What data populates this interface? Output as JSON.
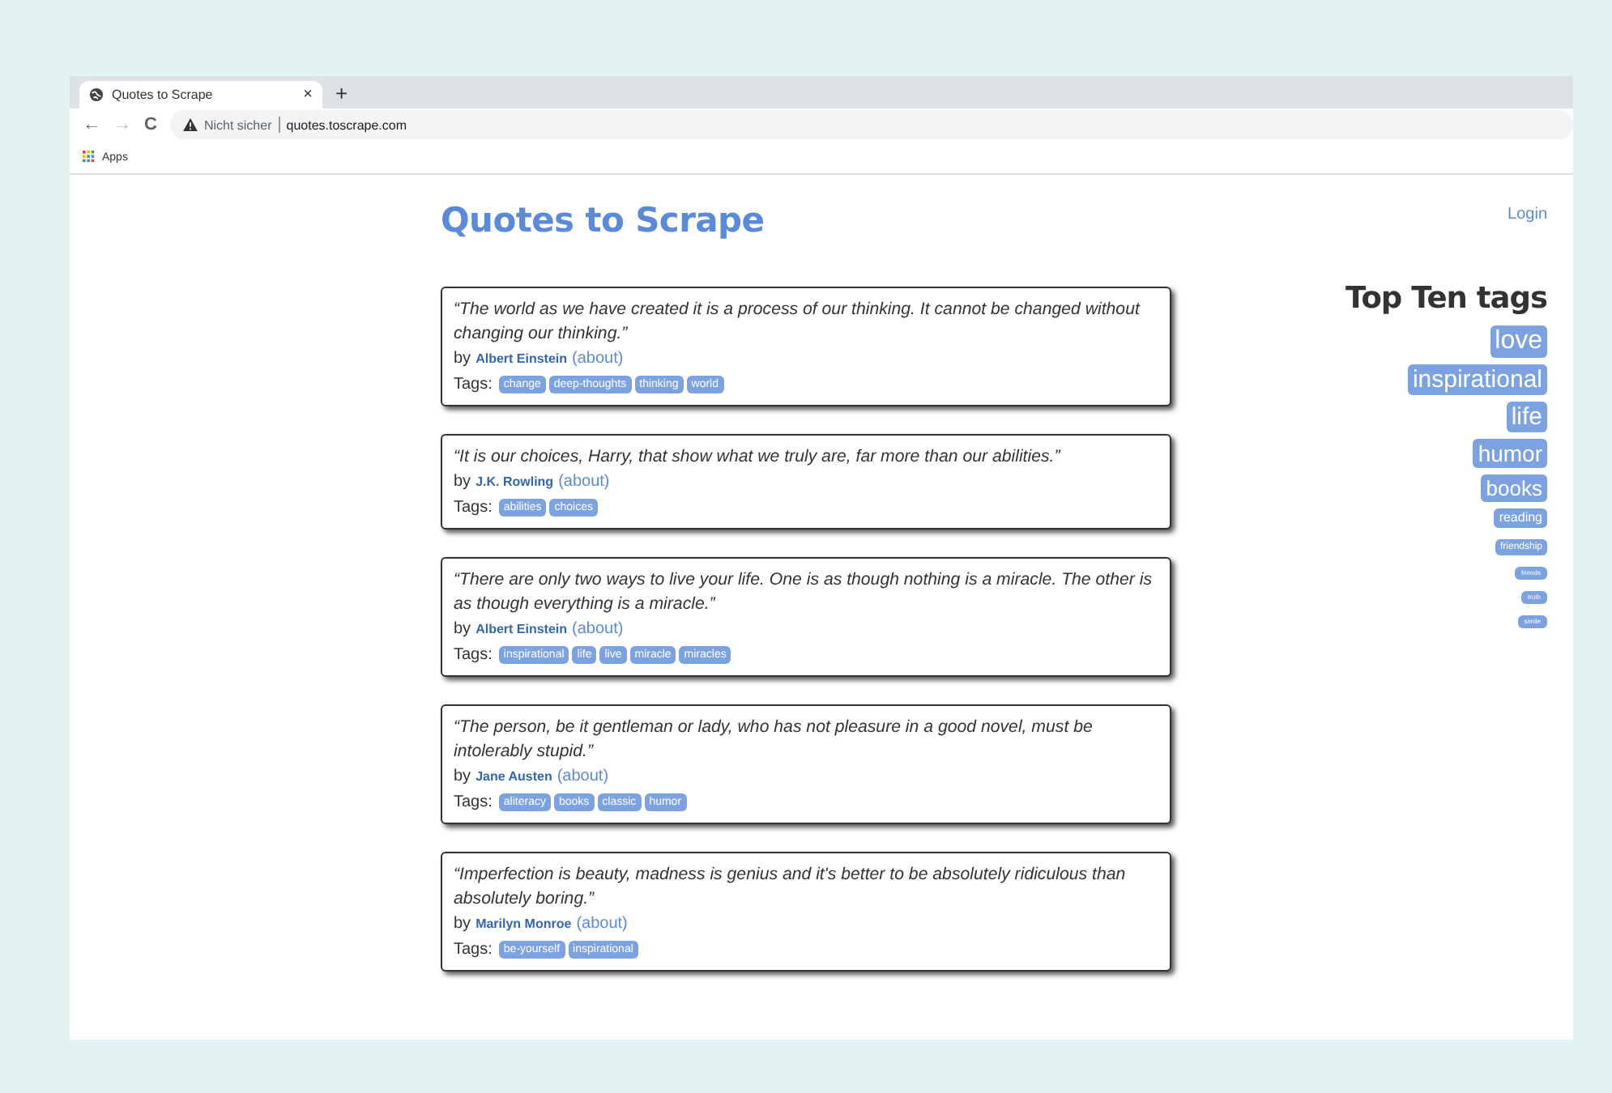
{
  "browser": {
    "tab_title": "Quotes to Scrape",
    "tab_close": "×",
    "new_tab": "+",
    "back": "←",
    "forward": "→",
    "reload": "C",
    "security": "Nicht sicher",
    "url": "quotes.toscrape.com",
    "bookmarks": [
      {
        "label": "Apps"
      }
    ]
  },
  "page": {
    "title": "Quotes to Scrape",
    "login": "Login",
    "quotes": [
      {
        "text": "“The world as we have created it is a process of our thinking. It cannot be changed without changing our thinking.”",
        "by": "by",
        "author": "Albert Einstein",
        "about": "(about)",
        "tags_label": "Tags:",
        "tags": [
          "change",
          "deep-thoughts",
          "thinking",
          "world"
        ]
      },
      {
        "text": "“It is our choices, Harry, that show what we truly are, far more than our abilities.”",
        "by": "by",
        "author": "J.K. Rowling",
        "about": "(about)",
        "tags_label": "Tags:",
        "tags": [
          "abilities",
          "choices"
        ]
      },
      {
        "text": "“There are only two ways to live your life. One is as though nothing is a miracle. The other is as though everything is a miracle.”",
        "by": "by",
        "author": "Albert Einstein",
        "about": "(about)",
        "tags_label": "Tags:",
        "tags": [
          "inspirational",
          "life",
          "live",
          "miracle",
          "miracles"
        ]
      },
      {
        "text": "“The person, be it gentleman or lady, who has not pleasure in a good novel, must be intolerably stupid.”",
        "by": "by",
        "author": "Jane Austen",
        "about": "(about)",
        "tags_label": "Tags:",
        "tags": [
          "aliteracy",
          "books",
          "classic",
          "humor"
        ]
      },
      {
        "text": "“Imperfection is beauty, madness is genius and it's better to be absolutely ridiculous than absolutely boring.”",
        "by": "by",
        "author": "Marilyn Monroe",
        "about": "(about)",
        "tags_label": "Tags:",
        "tags": [
          "be-yourself",
          "inspirational"
        ]
      }
    ],
    "top_tags": {
      "title": "Top Ten tags",
      "tags": [
        "love",
        "inspirational",
        "life",
        "humor",
        "books",
        "reading",
        "friendship",
        "friends",
        "truth",
        "simile"
      ]
    }
  }
}
